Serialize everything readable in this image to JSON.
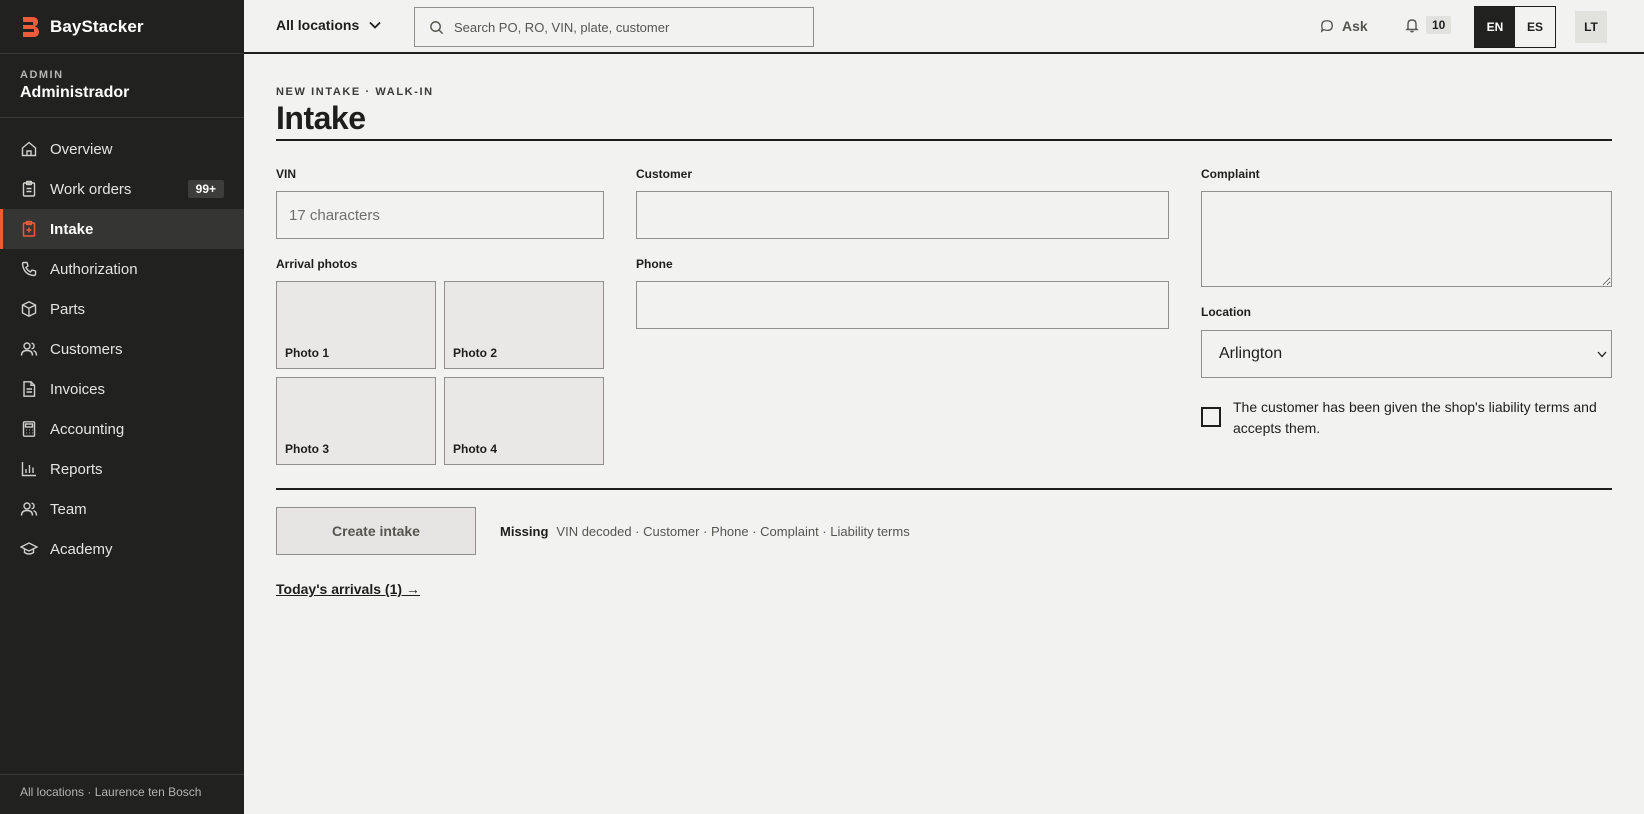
{
  "brand": {
    "name": "BayStacker",
    "accent": "#ee5b3a"
  },
  "topbar": {
    "location_selector": "All locations",
    "search_placeholder": "Search PO, RO, VIN, plate, customer",
    "ask_label": "Ask",
    "notification_count": "10",
    "languages": [
      "EN",
      "ES"
    ],
    "active_language": "EN",
    "avatar_initials": "LT"
  },
  "sidebar": {
    "role_label": "ADMIN",
    "role_name": "Administrador",
    "items": [
      {
        "label": "Overview",
        "icon": "home-icon"
      },
      {
        "label": "Work orders",
        "icon": "clipboard-icon",
        "badge": "99+"
      },
      {
        "label": "Intake",
        "icon": "clipboard-plus-icon",
        "active": true
      },
      {
        "label": "Authorization",
        "icon": "phone-icon"
      },
      {
        "label": "Parts",
        "icon": "box-icon"
      },
      {
        "label": "Customers",
        "icon": "users-icon"
      },
      {
        "label": "Invoices",
        "icon": "document-icon"
      },
      {
        "label": "Accounting",
        "icon": "calculator-icon"
      },
      {
        "label": "Reports",
        "icon": "bar-chart-icon"
      },
      {
        "label": "Team",
        "icon": "users-icon"
      },
      {
        "label": "Academy",
        "icon": "graduation-cap-icon"
      }
    ],
    "footer": "All locations · Laurence ten Bosch"
  },
  "page": {
    "eyebrow": "NEW INTAKE · WALK-IN",
    "title": "Intake"
  },
  "form": {
    "vin": {
      "label": "VIN",
      "placeholder": "17 characters",
      "value": ""
    },
    "customer": {
      "label": "Customer",
      "value": ""
    },
    "phone": {
      "label": "Phone",
      "value": ""
    },
    "complaint": {
      "label": "Complaint",
      "value": ""
    },
    "arrival_photos": {
      "label": "Arrival photos",
      "slots": [
        "Photo 1",
        "Photo 2",
        "Photo 3",
        "Photo 4"
      ]
    },
    "location": {
      "label": "Location",
      "selected": "Arlington"
    },
    "liability": {
      "label": "The customer has been given the shop's liability terms and accepts them.",
      "checked": false
    },
    "submit_label": "Create intake",
    "missing_label": "Missing",
    "missing_items": "VIN decoded · Customer · Phone · Complaint · Liability terms"
  },
  "arrivals_link": "Today's arrivals (1) →"
}
